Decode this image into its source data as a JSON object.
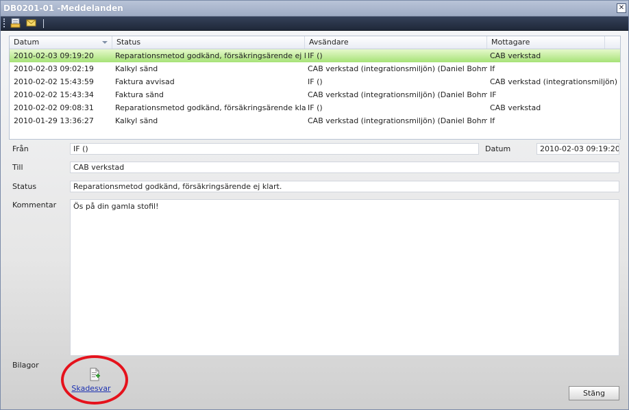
{
  "window": {
    "title": "DB0201-01 -Meddelanden",
    "close_glyph": "✕"
  },
  "toolbar": {
    "icons": [
      "open-message-icon",
      "new-message-icon"
    ]
  },
  "grid": {
    "columns": [
      "Datum",
      "Status",
      "Avsändare",
      "Mottagare"
    ],
    "rows": [
      {
        "datum": "2010-02-03 09:19:20",
        "status": "Reparationsmetod godkänd, försäkringsärende ej klart.",
        "avsandare": "IF ()",
        "mottagare": "CAB verkstad",
        "selected": true
      },
      {
        "datum": "2010-02-03 09:02:19",
        "status": "Kalkyl sänd",
        "avsandare": "CAB verkstad (integrationsmiljön)  (Daniel Bohman)",
        "mottagare": "If",
        "selected": false
      },
      {
        "datum": "2010-02-02 15:43:59",
        "status": "Faktura avvisad",
        "avsandare": "IF ()",
        "mottagare": "CAB verkstad (integrationsmiljön)",
        "selected": false
      },
      {
        "datum": "2010-02-02 15:43:34",
        "status": "Faktura sänd",
        "avsandare": "CAB verkstad (integrationsmiljön)  (Daniel Bohman)",
        "mottagare": "IF",
        "selected": false
      },
      {
        "datum": "2010-02-02 09:08:31",
        "status": "Reparationsmetod godkänd, försäkringsärende klart.",
        "avsandare": "IF ()",
        "mottagare": "CAB verkstad",
        "selected": false
      },
      {
        "datum": "2010-01-29 13:36:27",
        "status": "Kalkyl sänd",
        "avsandare": "CAB verkstad (integrationsmiljön)  (Daniel Bohman)",
        "mottagare": "If",
        "selected": false
      }
    ]
  },
  "details": {
    "fran_label": "Från",
    "fran_value": "IF ()",
    "datum_label": "Datum",
    "datum_value": "2010-02-03 09:19:20",
    "till_label": "Till",
    "till_value": "CAB verkstad",
    "status_label": "Status",
    "status_value": "Reparationsmetod godkänd, försäkringsärende ej klart.",
    "kommentar_label": "Kommentar",
    "kommentar_value": "Ös på din gamla stofil!",
    "bilagor_label": "Bilagor"
  },
  "attachment": {
    "label": "Skadesvar",
    "icon": "document-add-icon"
  },
  "buttons": {
    "close_label": "Stäng"
  },
  "colors": {
    "selected_row": "#a6e277",
    "highlight_circle": "#e5121c",
    "link": "#1a2fb0"
  }
}
